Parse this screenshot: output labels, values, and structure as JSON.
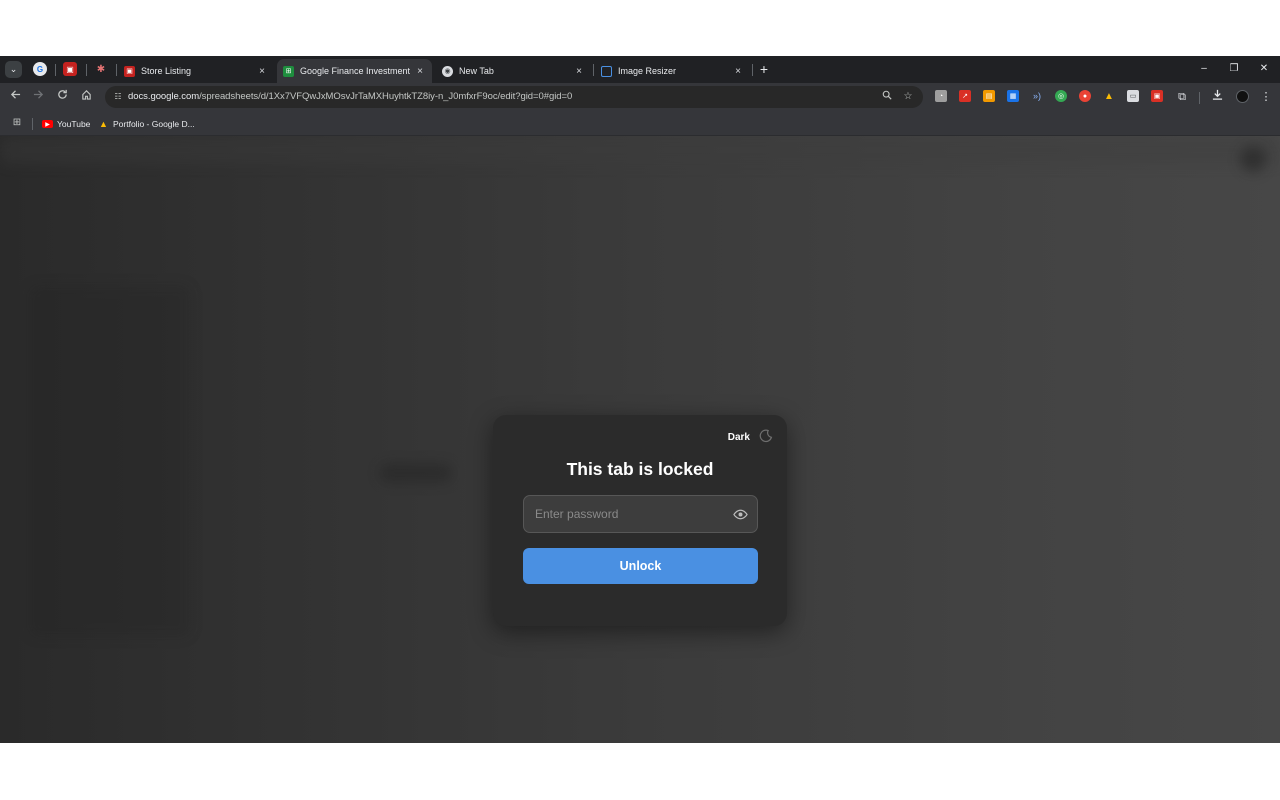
{
  "colors": {
    "accent": "#4a90e2",
    "dialog_bg": "#2b2b2b",
    "chrome_bg": "#202124",
    "toolbar_bg": "#35363a"
  },
  "tabs": {
    "pinned": [
      {
        "icon": "google-icon"
      },
      {
        "icon": "image-icon"
      },
      {
        "icon": "bug-icon"
      }
    ],
    "items": [
      {
        "title": "Store Listing",
        "icon": "image-icon",
        "active": false
      },
      {
        "title": "Google Finance Investment Tra",
        "icon": "sheets-icon",
        "active": true
      },
      {
        "title": "New Tab",
        "icon": "chrome-icon",
        "active": false
      },
      {
        "title": "Image Resizer",
        "icon": "crop-icon",
        "active": false
      }
    ],
    "close_glyph": "×",
    "new_tab_glyph": "+"
  },
  "window": {
    "minimize_glyph": "–",
    "restore_glyph": "❐",
    "close_glyph": "✕"
  },
  "toolbar": {
    "url_host": "docs.google.com",
    "url_path": "/spreadsheets/d/1Xx7VFQwJxMOsvJrTaMXHuyhtkTZ8iy-n_J0mfxrF9oc/edit?gid=0#gid=0",
    "extensions": [
      "ext-1",
      "ext-2",
      "ext-3",
      "ext-4",
      "ext-5",
      "ext-6",
      "ext-7",
      "ext-8",
      "ext-9",
      "ext-10",
      "ext-11"
    ]
  },
  "bookmarks": [
    {
      "label": "YouTube",
      "icon": "youtube-icon"
    },
    {
      "label": "Portfolio - Google D...",
      "icon": "drive-icon"
    }
  ],
  "lock_dialog": {
    "theme_label": "Dark",
    "title": "This tab is locked",
    "password_placeholder": "Enter password",
    "password_value": "",
    "unlock_label": "Unlock"
  }
}
